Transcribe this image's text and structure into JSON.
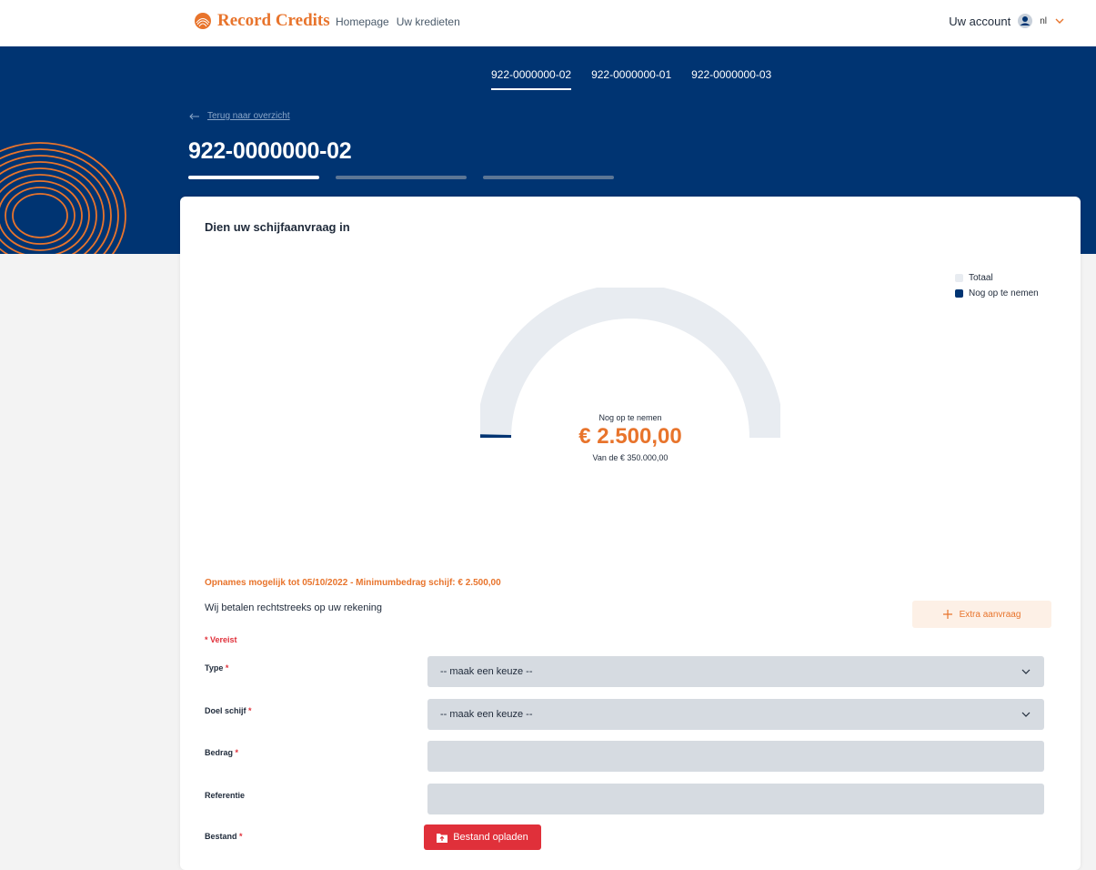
{
  "header": {
    "brand": "Record Credits",
    "nav": [
      "Homepage",
      "Uw kredieten"
    ],
    "account_label": "Uw account",
    "language": "nl"
  },
  "hero": {
    "tabs": [
      "922-0000000-02",
      "922-0000000-01",
      "922-0000000-03"
    ],
    "active_tab": 0,
    "back_link": "Terug naar overzicht",
    "title": "922-0000000-02",
    "steps": 3,
    "active_step": 0
  },
  "card": {
    "title": "Dien uw schijfaanvraag in",
    "legend": [
      {
        "label": "Totaal",
        "color": "#e8ecf1"
      },
      {
        "label": "Nog op te nemen",
        "color": "#003472"
      }
    ],
    "gauge": {
      "label": "Nog op te nemen",
      "value_text": "€ 2.500,00",
      "sub_text": "Van de € 350.000,00",
      "remaining": 2500,
      "total": 350000,
      "track_color": "#e8ecf1",
      "fill_color": "#003472"
    },
    "notice": "Opnames mogelijk tot 05/10/2022 - Minimumbedrag schijf: € 2.500,00",
    "pay_text": "Wij betalen rechtstreeks op uw rekening",
    "extra_button": "Extra aanvraag",
    "required_note": "* Vereist",
    "fields": {
      "type": {
        "label": "Type",
        "required": "*",
        "value": "-- maak een keuze --"
      },
      "doel": {
        "label": "Doel schijf",
        "required": "*",
        "value": "-- maak een keuze --"
      },
      "bedrag": {
        "label": "Bedrag",
        "required": "*",
        "value": ""
      },
      "referentie": {
        "label": "Referentie",
        "value": ""
      },
      "bestand": {
        "label": "Bestand",
        "required": "*",
        "button": "Bestand opladen"
      }
    }
  },
  "colors": {
    "brand_orange": "#e8742c",
    "navy": "#003472",
    "red": "#e0303a"
  }
}
